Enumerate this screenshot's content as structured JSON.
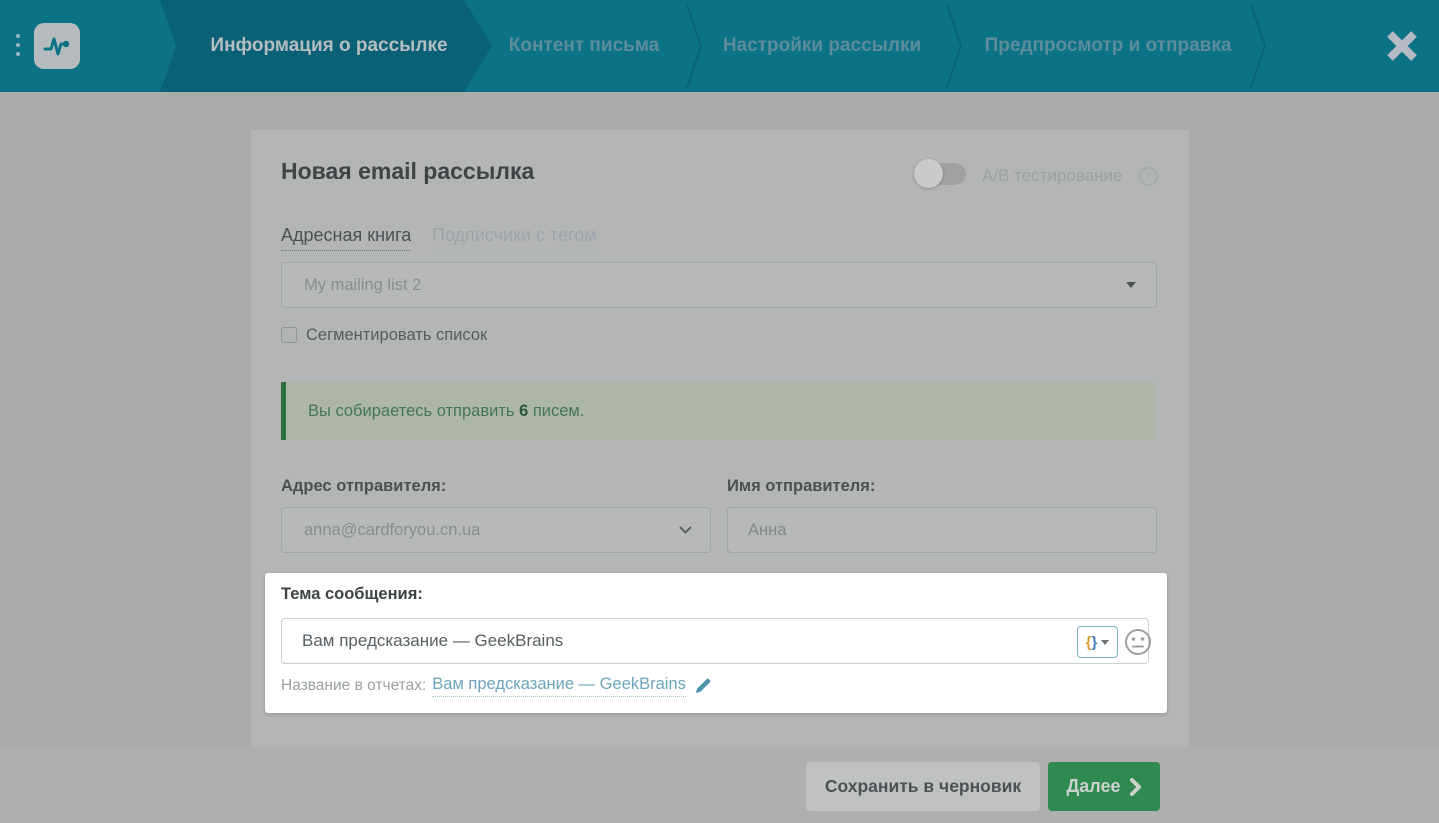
{
  "colors": {
    "header_teal": "#0c7285",
    "header_active_teal": "#0a6175",
    "accent_green": "#2e8a50",
    "alert_green": "#2e7040",
    "link_teal": "#6fa5bc"
  },
  "header": {
    "steps": [
      {
        "label": "Информация о рассылке",
        "active": true
      },
      {
        "label": "Контент письма",
        "active": false
      },
      {
        "label": "Настройки рассылки",
        "active": false
      },
      {
        "label": "Предпросмотр и отправка",
        "active": false
      }
    ]
  },
  "form": {
    "title": "Новая email рассылка",
    "ab_test": {
      "label": "А/В тестирование",
      "state": "off",
      "help_glyph": "?"
    },
    "tabs": [
      {
        "label": "Адресная книга",
        "active": true
      },
      {
        "label": "Подписчики с тегом",
        "active": false
      }
    ],
    "mailing_list_select": {
      "value": "My mailing list 2"
    },
    "segment_checkbox": {
      "label": "Сегментировать список",
      "checked": false
    },
    "alert": {
      "text_before": "Вы собираетесь отправить ",
      "count": "6",
      "text_after": " писем."
    },
    "sender_email": {
      "label": "Адрес отправителя:",
      "value": "anna@cardforyou.cn.ua"
    },
    "sender_name": {
      "label": "Имя отправителя:",
      "value": "Анна"
    },
    "subject": {
      "label": "Тема сообщения:",
      "value": "Вам предсказание — GeekBrains",
      "variables_open": "{",
      "variables_close": "}"
    },
    "report_name": {
      "label": "Название в отчетах:",
      "value": "Вам предсказание — GeekBrains"
    }
  },
  "footer": {
    "save_draft": "Сохранить в черновик",
    "next": "Далее"
  }
}
